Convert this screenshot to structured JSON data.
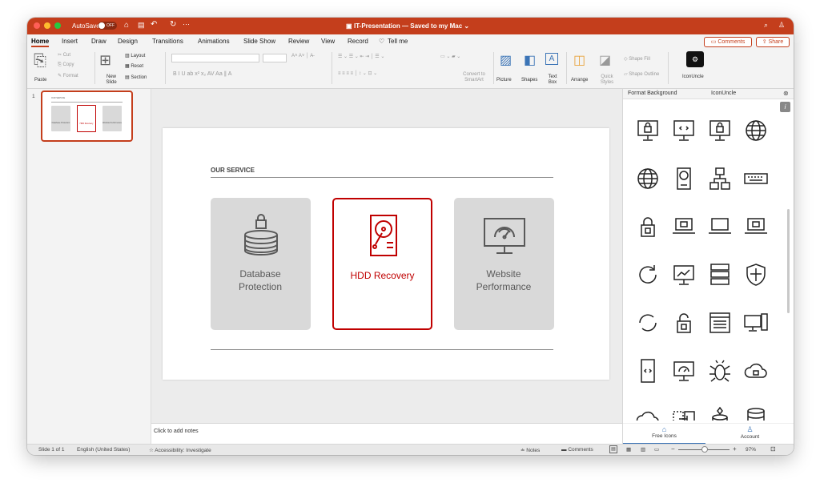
{
  "titlebar": {
    "autosave": "AutoSave",
    "autosave_state": "OFF",
    "doc_title": "IT-Presentation — Saved to my Mac ⌄"
  },
  "menu_tabs": [
    "Home",
    "Insert",
    "Draw",
    "Design",
    "Transitions",
    "Animations",
    "Slide Show",
    "Review",
    "View",
    "Record"
  ],
  "tell_me": "Tell me",
  "comments_btn": "Comments",
  "share_btn": "Share",
  "ribbon": {
    "cut": "Cut",
    "copy": "Copy",
    "format": "Format",
    "paste": "Paste",
    "new_slide": "New Slide",
    "layout": "Layout",
    "reset": "Reset",
    "section": "Section",
    "convert": "Convert to SmartArt",
    "picture": "Picture",
    "shapes": "Shapes",
    "text_box": "Text Box",
    "arrange": "Arrange",
    "quick_styles": "Quick Styles",
    "shape_fill": "Shape Fill",
    "shape_outline": "Shape Outline",
    "iconuncle": "IconUncle"
  },
  "thumbnail": {
    "number": "1",
    "header": "OUR SERVICE",
    "card1": "Database Protection",
    "card2": "HDD Recovery",
    "card3": "Website Performance"
  },
  "slide": {
    "heading": "OUR SERVICE",
    "cards": [
      {
        "label": "Database Protection"
      },
      {
        "label": "HDD Recovery"
      },
      {
        "label": "Website Performance"
      }
    ]
  },
  "notes_placeholder": "Click to add notes",
  "panel": {
    "tab1": "Format Background",
    "tab2": "IconUncle",
    "free_icons": "Free Icons",
    "account": "Account"
  },
  "status": {
    "slide": "Slide 1 of 1",
    "language": "English (United States)",
    "accessibility": "Accessibility: Investigate",
    "notes": "Notes",
    "comments": "Comments",
    "zoom": "97%"
  },
  "colors": {
    "accent": "#c43e1c",
    "highlight": "#c00000",
    "card_gray": "#d9d9d9"
  }
}
